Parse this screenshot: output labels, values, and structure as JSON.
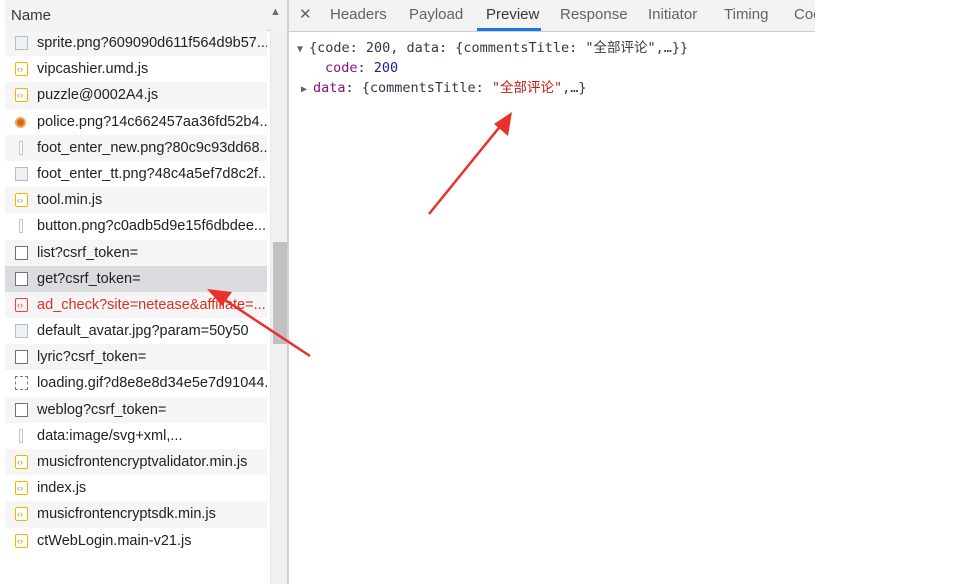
{
  "name_column": {
    "header": "Name",
    "sort_icon": "sort-up-triangle-icon",
    "rows": [
      {
        "label": "sprite.png?609090d611f564d9b57...",
        "icon": "image-icon",
        "type": "img"
      },
      {
        "label": "vipcashier.umd.js",
        "icon": "script-icon",
        "type": "js"
      },
      {
        "label": "puzzle@0002A4.js",
        "icon": "script-icon",
        "type": "js"
      },
      {
        "label": "police.png?14c662457aa36fd52b4...",
        "icon": "police-badge-icon",
        "type": "police"
      },
      {
        "label": "foot_enter_new.png?80c9c93dd68...",
        "icon": "thin-image-icon",
        "type": "thin"
      },
      {
        "label": "foot_enter_tt.png?48c4a5ef7d8c2f...",
        "icon": "image-icon",
        "type": "img"
      },
      {
        "label": "tool.min.js",
        "icon": "script-icon",
        "type": "js"
      },
      {
        "label": "button.png?c0adb5d9e15f6dbdee...",
        "icon": "thin-image-icon",
        "type": "thin"
      },
      {
        "label": "list?csrf_token=",
        "icon": "document-icon",
        "type": "doc"
      },
      {
        "label": "get?csrf_token=",
        "icon": "document-icon",
        "type": "doc",
        "selected": true
      },
      {
        "label": "ad_check?site=netease&affiliate=...",
        "icon": "error-script-icon",
        "type": "err"
      },
      {
        "label": "default_avatar.jpg?param=50y50",
        "icon": "image-icon",
        "type": "img"
      },
      {
        "label": "lyric?csrf_token=",
        "icon": "document-icon",
        "type": "doc"
      },
      {
        "label": "loading.gif?d8e8e8d34e5e7d91044...",
        "icon": "gif-icon",
        "type": "gif"
      },
      {
        "label": "weblog?csrf_token=",
        "icon": "document-icon",
        "type": "doc"
      },
      {
        "label": "data:image/svg+xml,...",
        "icon": "thin-image-icon",
        "type": "thin"
      },
      {
        "label": "musicfrontencryptvalidator.min.js",
        "icon": "script-icon",
        "type": "js"
      },
      {
        "label": "index.js",
        "icon": "script-icon",
        "type": "js"
      },
      {
        "label": "musicfrontencryptsdk.min.js",
        "icon": "script-icon",
        "type": "js"
      },
      {
        "label": "ctWebLogin.main-v21.js",
        "icon": "script-icon",
        "type": "js"
      }
    ]
  },
  "tabs": {
    "close_icon": "close-icon",
    "items": [
      {
        "label": "Headers"
      },
      {
        "label": "Payload"
      },
      {
        "label": "Preview",
        "active": true
      },
      {
        "label": "Response"
      },
      {
        "label": "Initiator"
      },
      {
        "label": "Timing"
      },
      {
        "label": "Coo"
      }
    ]
  },
  "preview": {
    "root_line": "{code: 200, data: {commentsTitle: \"全部评论\",…}}",
    "code_key": "code",
    "code_value": "200",
    "data_key": "data",
    "data_value_open": "{commentsTitle: ",
    "data_value_str": "\"全部评论\"",
    "data_value_close": ",…}",
    "expand_icon": "triangle-down-icon",
    "collapse_icon": "triangle-right-icon"
  },
  "colors": {
    "accent": "#1a73e8",
    "annotation_arrow": "#e8312a",
    "error_text": "#d93025",
    "json_key": "#881280",
    "json_number": "#1a1aa6",
    "json_string": "#c41a16"
  }
}
